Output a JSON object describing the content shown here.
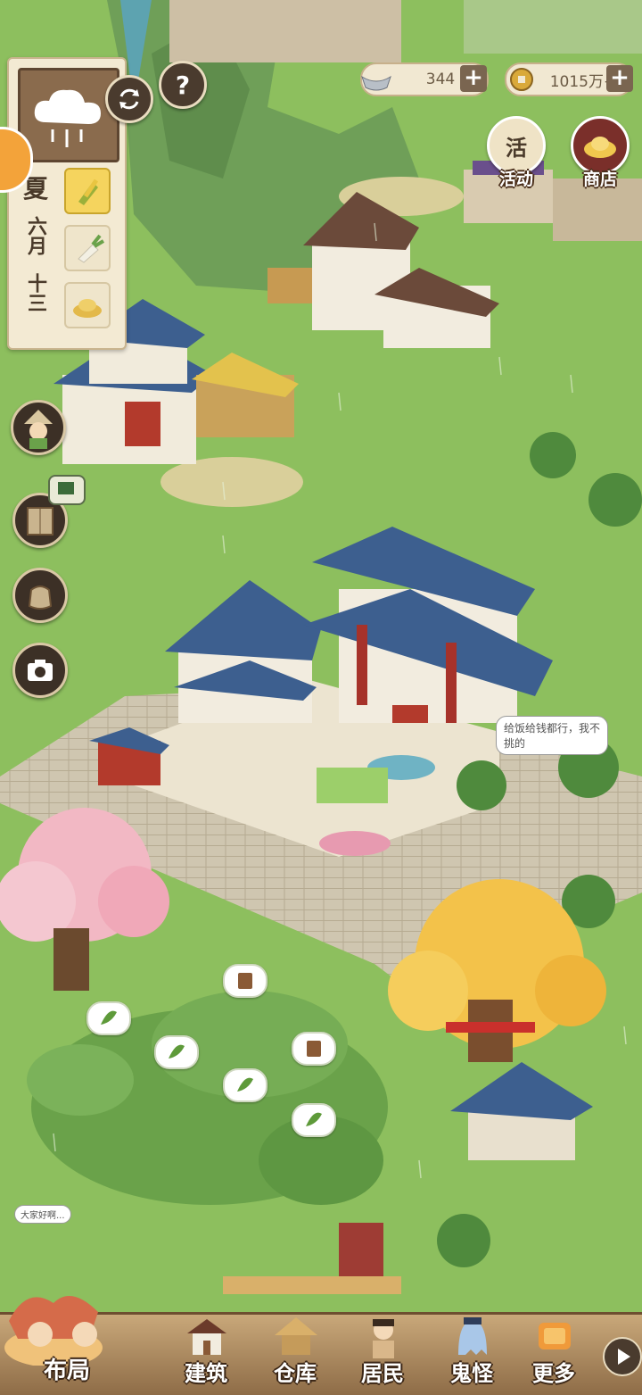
{
  "weather": {
    "icon": "rain-cloud-icon"
  },
  "calendar": {
    "season": "夏",
    "month": "六月",
    "day": "十三"
  },
  "crops": [
    {
      "icon": "corn-icon",
      "active": true
    },
    {
      "icon": "radish-icon",
      "active": false
    },
    {
      "icon": "grain-pile-icon",
      "active": false
    }
  ],
  "help": {
    "label": "?"
  },
  "resources": {
    "silver": {
      "icon": "silver-ingot-icon",
      "value": "344"
    },
    "coins": {
      "icon": "copper-coin-icon",
      "value": "1015万+"
    }
  },
  "top_buttons": {
    "events": {
      "label": "活动",
      "icon_text": "活"
    },
    "shop": {
      "label": "商店"
    }
  },
  "scene": {
    "speech_resident": "给饭给钱都行，我不挑的",
    "speech_visitor": "大家好啊..."
  },
  "bottom_nav": [
    {
      "label": "布局",
      "icon": "layout-icon"
    },
    {
      "label": "建筑",
      "icon": "building-icon"
    },
    {
      "label": "仓库",
      "icon": "warehouse-icon"
    },
    {
      "label": "居民",
      "icon": "resident-icon"
    },
    {
      "label": "鬼怪",
      "icon": "ghost-icon"
    },
    {
      "label": "更多",
      "icon": "more-icon"
    }
  ],
  "colors": {
    "grass": "#8cbf5c",
    "roof_blue": "#3d5f8f",
    "panel": "#f3ead3",
    "bar_brown": "#8e6c47"
  }
}
